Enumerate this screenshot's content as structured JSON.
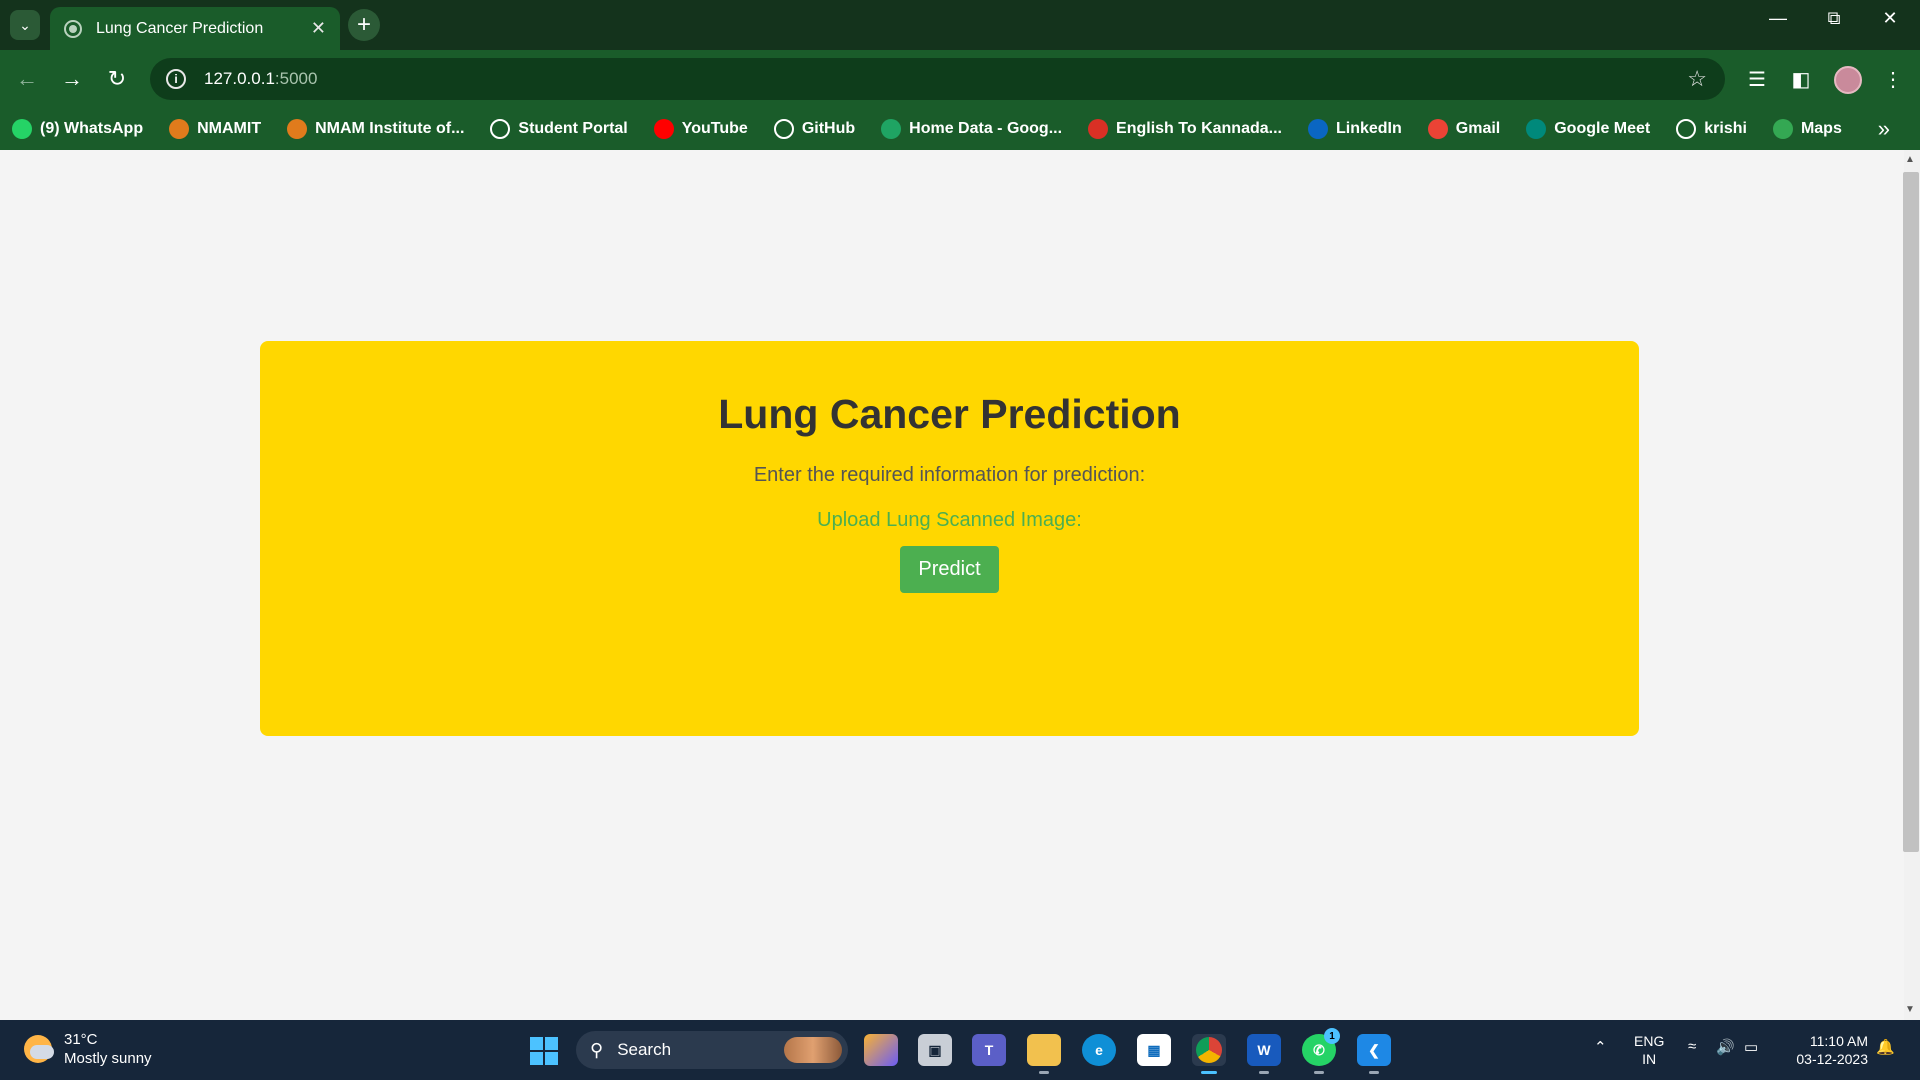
{
  "browser": {
    "tab_title": "Lung Cancer Prediction",
    "url_host": "127.0.0.1",
    "url_port": ":5000"
  },
  "bookmarks": [
    {
      "label": "(9) WhatsApp",
      "icon": "whatsapp-icon",
      "color": "#25d366"
    },
    {
      "label": "NMAMIT",
      "icon": "nmamit-icon",
      "color": "#e07b1c"
    },
    {
      "label": "NMAM Institute of...",
      "icon": "nmamit-icon",
      "color": "#e07b1c"
    },
    {
      "label": "Student Portal",
      "icon": "globe-icon",
      "color": "#ffffff"
    },
    {
      "label": "YouTube",
      "icon": "youtube-icon",
      "color": "#ff0000"
    },
    {
      "label": "GitHub",
      "icon": "github-icon",
      "color": "#ffffff"
    },
    {
      "label": "Home Data - Goog...",
      "icon": "sheets-icon",
      "color": "#1fa463"
    },
    {
      "label": "English To Kannada...",
      "icon": "translate-icon",
      "color": "#d93025"
    },
    {
      "label": "LinkedIn",
      "icon": "linkedin-icon",
      "color": "#0a66c2"
    },
    {
      "label": "Gmail",
      "icon": "gmail-icon",
      "color": "#ea4335"
    },
    {
      "label": "Google Meet",
      "icon": "meet-icon",
      "color": "#00897b"
    },
    {
      "label": "krishi",
      "icon": "globe-icon",
      "color": "#ffffff"
    },
    {
      "label": "Maps",
      "icon": "maps-icon",
      "color": "#34a853"
    }
  ],
  "main": {
    "title": "Lung Cancer Prediction",
    "subtitle": "Enter the required information for prediction:",
    "upload_label": "Upload Lung Scanned Image:",
    "predict_label": "Predict"
  },
  "taskbar": {
    "temperature": "31°C",
    "weather": "Mostly sunny",
    "search_label": "Search",
    "lang_1": "ENG",
    "lang_2": "IN",
    "time": "11:10 AM",
    "date": "03-12-2023",
    "whatsapp_badge": "1"
  },
  "colors": {
    "card": "#ffd700",
    "button": "#4caf50",
    "upload_text": "#4caf50",
    "browser_frame": "#1a5c2a"
  }
}
